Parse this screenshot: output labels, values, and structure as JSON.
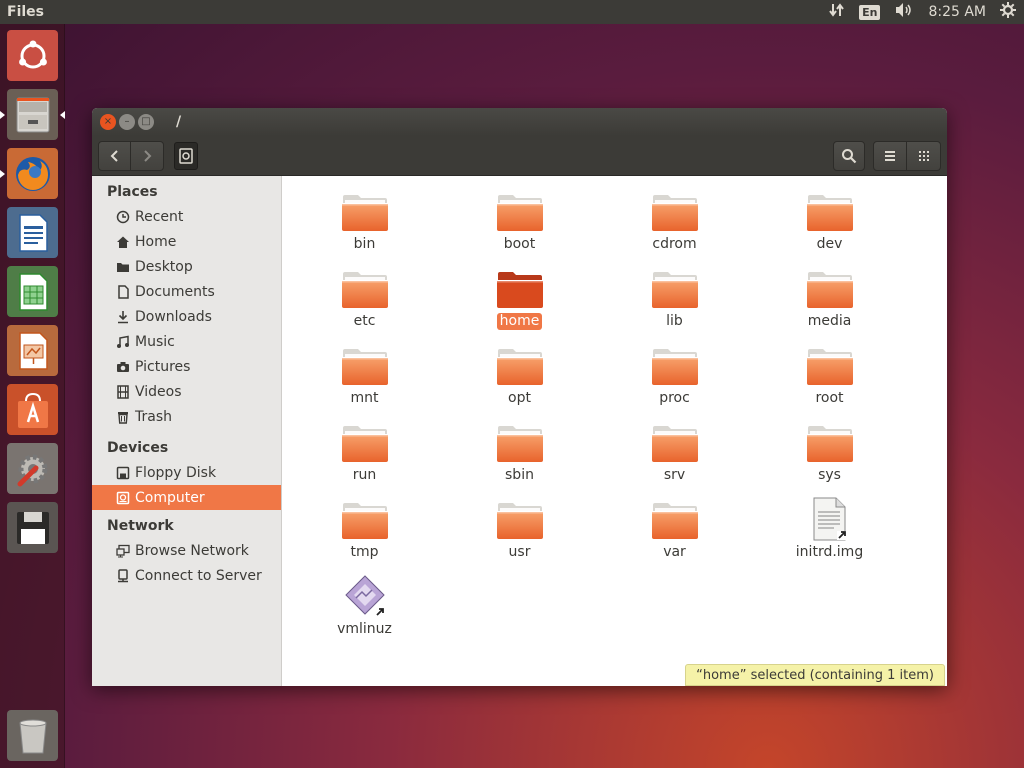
{
  "top_panel": {
    "app_title": "Files",
    "keyboard_layout": "En",
    "clock": "8:25 AM",
    "icons": [
      "network-icon",
      "keyboard-layout-indicator",
      "volume-icon",
      "system-gear-icon"
    ]
  },
  "launcher": {
    "items": [
      {
        "name": "ubuntu-dash",
        "icon": "ubuntu-logo-icon"
      },
      {
        "name": "files",
        "icon": "file-cabinet-icon",
        "running": true,
        "focused": true
      },
      {
        "name": "firefox",
        "icon": "firefox-icon",
        "running": true
      },
      {
        "name": "libreoffice-writer",
        "icon": "writer-icon"
      },
      {
        "name": "libreoffice-calc",
        "icon": "calc-icon"
      },
      {
        "name": "libreoffice-impress",
        "icon": "impress-icon"
      },
      {
        "name": "software-center",
        "icon": "shopping-bag-icon"
      },
      {
        "name": "system-settings",
        "icon": "settings-wrench-icon"
      },
      {
        "name": "floppy",
        "icon": "floppy-icon"
      },
      {
        "name": "trash",
        "icon": "trash-can-icon"
      }
    ]
  },
  "window": {
    "title": "/",
    "close_glyph": "×",
    "min_glyph": "–",
    "max_glyph": "□"
  },
  "sidebar": {
    "places_header": "Places",
    "places": [
      {
        "label": "Recent",
        "icon": "clock-icon"
      },
      {
        "label": "Home",
        "icon": "home-icon"
      },
      {
        "label": "Desktop",
        "icon": "folder-icon"
      },
      {
        "label": "Documents",
        "icon": "document-icon"
      },
      {
        "label": "Downloads",
        "icon": "download-icon"
      },
      {
        "label": "Music",
        "icon": "music-note-icon"
      },
      {
        "label": "Pictures",
        "icon": "camera-icon"
      },
      {
        "label": "Videos",
        "icon": "film-icon"
      },
      {
        "label": "Trash",
        "icon": "trash-icon"
      }
    ],
    "devices_header": "Devices",
    "devices": [
      {
        "label": "Floppy Disk",
        "icon": "floppy-drive-icon"
      },
      {
        "label": "Computer",
        "icon": "computer-drive-icon",
        "selected": true
      }
    ],
    "network_header": "Network",
    "network": [
      {
        "label": "Browse Network",
        "icon": "network-icon"
      },
      {
        "label": "Connect to Server",
        "icon": "server-icon"
      }
    ]
  },
  "files": [
    {
      "label": "bin",
      "type": "folder"
    },
    {
      "label": "boot",
      "type": "folder"
    },
    {
      "label": "cdrom",
      "type": "folder"
    },
    {
      "label": "dev",
      "type": "folder"
    },
    {
      "label": "etc",
      "type": "folder"
    },
    {
      "label": "home",
      "type": "folder",
      "selected": true
    },
    {
      "label": "lib",
      "type": "folder"
    },
    {
      "label": "media",
      "type": "folder"
    },
    {
      "label": "mnt",
      "type": "folder"
    },
    {
      "label": "opt",
      "type": "folder"
    },
    {
      "label": "proc",
      "type": "folder"
    },
    {
      "label": "root",
      "type": "folder"
    },
    {
      "label": "run",
      "type": "folder"
    },
    {
      "label": "sbin",
      "type": "folder"
    },
    {
      "label": "srv",
      "type": "folder"
    },
    {
      "label": "sys",
      "type": "folder"
    },
    {
      "label": "tmp",
      "type": "folder"
    },
    {
      "label": "usr",
      "type": "folder"
    },
    {
      "label": "var",
      "type": "folder"
    },
    {
      "label": "initrd.img",
      "type": "file-link"
    },
    {
      "label": "vmlinuz",
      "type": "binary-link"
    }
  ],
  "status": {
    "text": "“home” selected  (containing 1 item)"
  },
  "colors": {
    "accent": "#f07746",
    "folder_top": "#f7a06a",
    "folder_bottom": "#e8632c",
    "folder_selected": "#d94a1e",
    "panel": "#3c3b37"
  }
}
